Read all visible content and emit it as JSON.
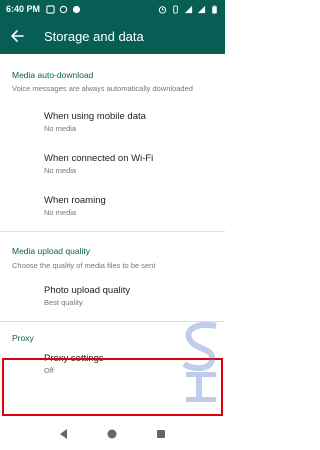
{
  "status_bar": {
    "time": "6:40 PM",
    "icons_left": [
      "notification-icon",
      "sync-icon",
      "whatsapp-icon"
    ],
    "icons_right": [
      "alarm-icon",
      "vibrate-icon",
      "signal-icon",
      "signal-icon",
      "battery-icon"
    ]
  },
  "app_bar": {
    "title": "Storage and data",
    "back_icon": "arrow-back-icon"
  },
  "media_auto_download": {
    "header": "Media auto-download",
    "subtitle": "Voice messages are always automatically downloaded",
    "items": [
      {
        "title": "When using mobile data",
        "value": "No media"
      },
      {
        "title": "When connected on Wi-Fi",
        "value": "No media"
      },
      {
        "title": "When roaming",
        "value": "No media"
      }
    ]
  },
  "media_upload_quality": {
    "header": "Media upload quality",
    "subtitle": "Choose the quality of media files to be sent",
    "items": [
      {
        "title": "Photo upload quality",
        "value": "Best quality"
      }
    ]
  },
  "proxy": {
    "header": "Proxy",
    "items": [
      {
        "title": "Proxy settings",
        "value": "Off"
      }
    ]
  },
  "colors": {
    "primary": "#075e54",
    "highlight_border": "#e0000a",
    "divider": "#dddddd"
  },
  "nav_bar": {
    "buttons": [
      "back-triangle-icon",
      "home-circle-icon",
      "recents-square-icon"
    ]
  }
}
